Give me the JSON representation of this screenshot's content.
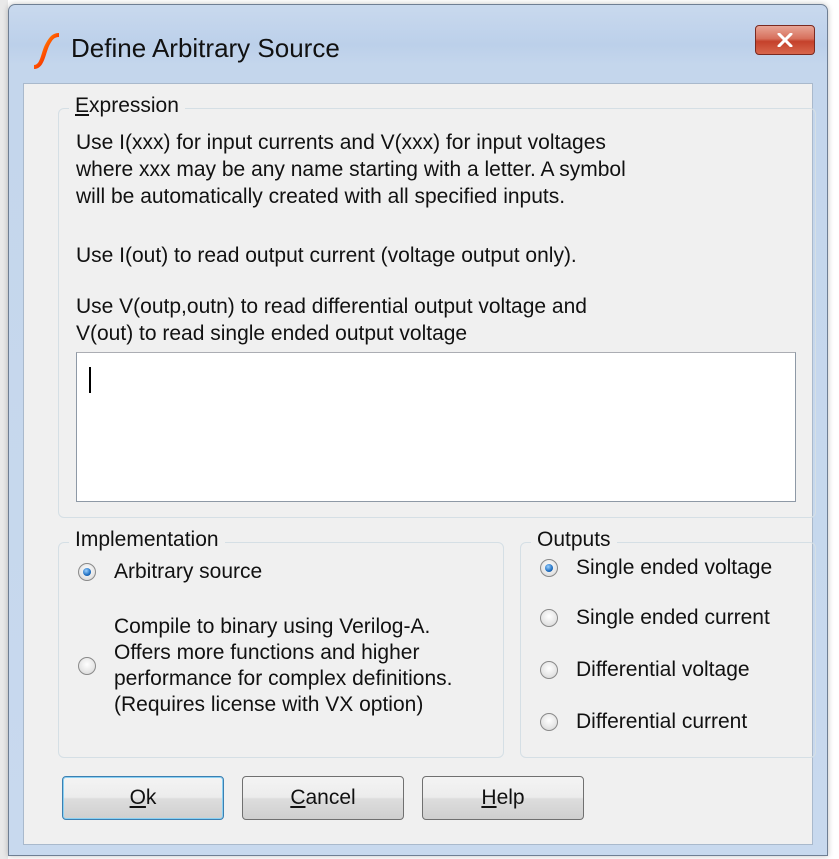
{
  "window": {
    "title": "Define Arbitrary Source",
    "close_label": "✕"
  },
  "expression": {
    "group_label_mnemonic": "E",
    "group_label_rest": "xpression",
    "lines": [
      "Use I(xxx) for input currents and V(xxx) for input voltages",
      "where xxx may be any name starting with a letter. A symbol",
      "will be automatically created with all specified inputs."
    ],
    "output_current_line": "Use I(out) to read output current (voltage output only).",
    "differential_lines": [
      "Use V(outp,outn) to read differential output voltage and",
      "V(out) to read single ended output voltage"
    ],
    "input_value": ""
  },
  "implementation": {
    "group_label": "Implementation",
    "options": [
      {
        "label": "Arbitrary source",
        "checked": true
      },
      {
        "label_lines": [
          "Compile to binary using Verilog-A.",
          "Offers more functions and higher",
          "performance for complex definitions.",
          "(Requires license with VX option)"
        ],
        "checked": false
      }
    ]
  },
  "outputs": {
    "group_label": "Outputs",
    "options": [
      {
        "label": "Single ended voltage",
        "checked": true
      },
      {
        "label": "Single ended current",
        "checked": false
      },
      {
        "label": "Differential voltage",
        "checked": false
      },
      {
        "label": "Differential current",
        "checked": false
      }
    ]
  },
  "buttons": {
    "ok_mnemonic": "O",
    "ok_rest": "k",
    "cancel_mnemonic": "C",
    "cancel_rest": "ancel",
    "help_mnemonic": "H",
    "help_rest": "elp"
  }
}
